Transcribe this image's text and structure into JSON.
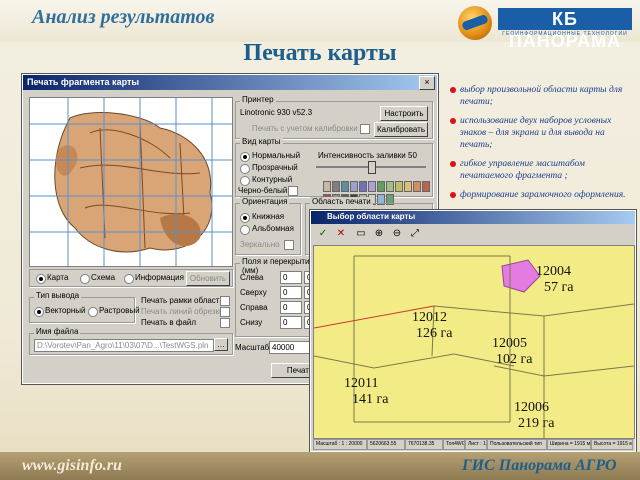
{
  "slide": {
    "subtitle": "Анализ результатов",
    "title": "Печать карты",
    "website": "www.gisinfo.ru",
    "product": "ГИС Панорама АГРО",
    "logo_text": "КБ ПАНОРАМА",
    "logo_tagline": "ГЕОИНФОРМАЦИОННЫЕ ТЕХНОЛОГИИ"
  },
  "bullets": [
    "выбор произвольной области карты для печати;",
    "использование двух наборов условных знаков – для экрана и для вывода на печать;",
    "гибкое управление масштабом печатаемого фрагмента ;",
    "формирование зарамочного оформления."
  ],
  "dialog": {
    "title": "Печать фрагмента карты",
    "close": "×",
    "printer": {
      "legend": "Принтер",
      "name": "Linotronic 930 v52.3",
      "setup_btn": "Настроить",
      "calib_label": "Печать с учетом калибровки",
      "calib_btn": "Калибровать"
    },
    "view": {
      "legend": "Вид карты",
      "options": [
        "Нормальный",
        "Прозрачный",
        "Контурный"
      ],
      "selected": "Нормальный",
      "intensity_label": "Интенсивность заливки",
      "intensity_value": "50",
      "bw_label": "Черно-белый"
    },
    "orientation": {
      "legend": "Ориентация",
      "options": [
        "Книжная",
        "Альбомная"
      ],
      "selected": "Книжная",
      "mirror_label": "Зеркально"
    },
    "area": {
      "legend": "Область печати"
    },
    "show": {
      "options": [
        "Карта",
        "Схема",
        "Информация"
      ],
      "selected": "Карта",
      "refresh_btn": "Обновить"
    },
    "output": {
      "legend": "Тип вывода",
      "options": [
        "Векторный",
        "Растровый"
      ],
      "selected": "Векторный",
      "checks": [
        "Печать рамки области",
        "Печать линий обрезки",
        "Печать в файл"
      ]
    },
    "fields": {
      "legend": "Поля и перекрытия (мм)",
      "rows": [
        {
          "label": "Слева",
          "a": "0",
          "b": "0"
        },
        {
          "label": "Сверху",
          "a": "0",
          "b": "0"
        },
        {
          "label": "Справа",
          "a": "0",
          "b": "0"
        },
        {
          "label": "Снизу",
          "a": "0",
          "b": "0"
        }
      ]
    },
    "scale": {
      "label": "Масштаб",
      "value": "40000"
    },
    "file": {
      "legend": "Имя файла",
      "path": "D:\\Vorotev\\Pan_Agro\\11\\03\\07\\D...\\TestWGS.pln"
    },
    "print_btn": "Печать"
  },
  "swatch_colors": [
    "#c8b8a0",
    "#808080",
    "#5f8f9f",
    "#9aa0c8",
    "#7070c0",
    "#b0a0d0",
    "#60a060",
    "#a0c080",
    "#c0c060",
    "#e0c070",
    "#d09060",
    "#c06050",
    "#a05060",
    "#909090",
    "#606060",
    "#404040",
    "#b0b0b0",
    "#d0d0d0",
    "#8fb8d8",
    "#70a070"
  ],
  "dialog2": {
    "title": "Выбор области карты",
    "toolbar_icons": [
      "check-icon",
      "close-icon",
      "rect-select-icon",
      "zoom-in-icon",
      "zoom-out-icon",
      "fit-icon"
    ],
    "parcels": [
      {
        "id": "12004",
        "area": "57 га"
      },
      {
        "id": "12012",
        "area": "126 га"
      },
      {
        "id": "12005",
        "area": "102 га"
      },
      {
        "id": "12011",
        "area": "141 га"
      },
      {
        "id": "12006",
        "area": "219 га"
      }
    ],
    "status": [
      "Масштаб : 1 : 20000",
      "5620663.55",
      "7670138.35",
      "Топ4WG",
      "Лист : 1",
      "Пользовательский тип",
      "Ширина = 1915 м",
      "Высота = 1915 м"
    ]
  }
}
